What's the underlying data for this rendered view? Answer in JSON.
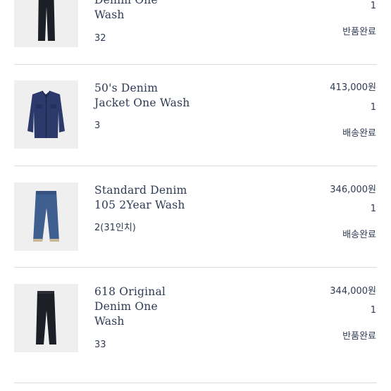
{
  "orders": [
    {
      "name_lines": [
        "Denim One",
        "Wash"
      ],
      "option": "32",
      "price": "",
      "quantity": "1",
      "status": "반품완료",
      "product_icon": "jeans-dark-icon"
    },
    {
      "name_lines": [
        "50's Denim",
        "Jacket One Wash"
      ],
      "option": "3",
      "price": "413,000원",
      "quantity": "1",
      "status": "배송완료",
      "product_icon": "denim-jacket-icon"
    },
    {
      "name_lines": [
        "Standard Denim",
        "105 2Year Wash"
      ],
      "option": "2(31인치)",
      "price": "346,000원",
      "quantity": "1",
      "status": "배송완료",
      "product_icon": "jeans-light-icon"
    },
    {
      "name_lines": [
        "618 Original",
        "Denim One",
        "Wash"
      ],
      "option": "33",
      "price": "344,000원",
      "quantity": "1",
      "status": "반품완료",
      "product_icon": "jeans-dark-icon"
    }
  ]
}
